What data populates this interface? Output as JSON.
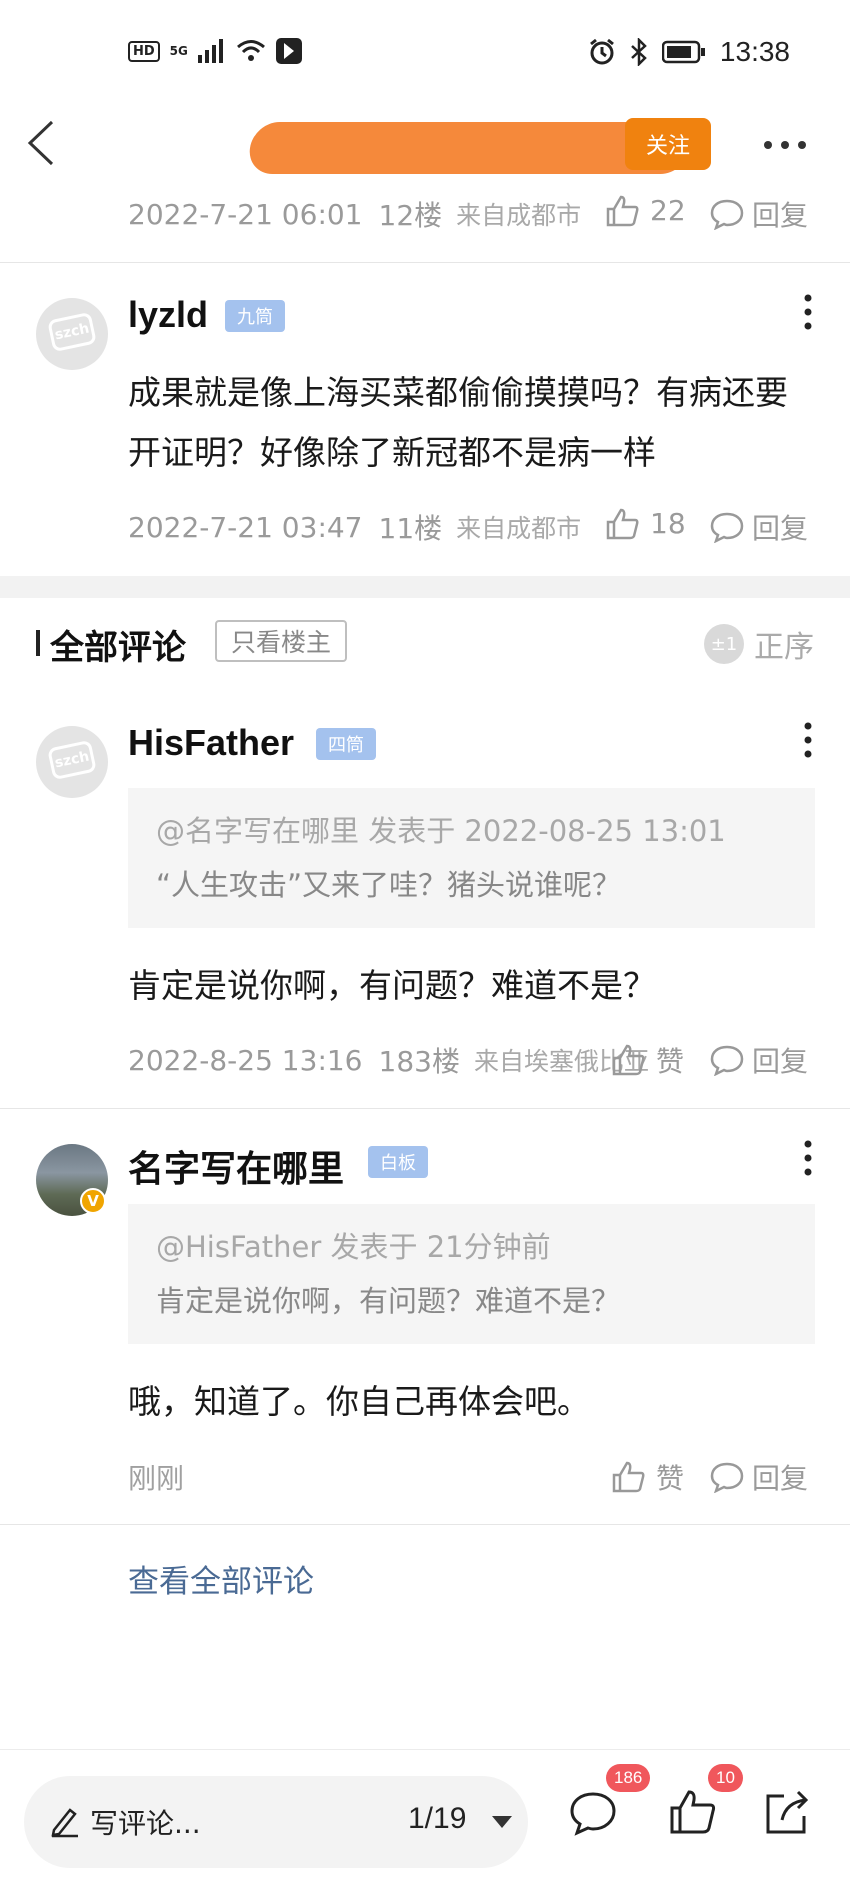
{
  "status_bar": {
    "hd": "HD",
    "network": "5G",
    "time": "13:38"
  },
  "nav": {
    "follow_label": "关注"
  },
  "comments_top": [
    {
      "date": "2022-7-21 06:01",
      "floor": "12楼",
      "from": "来自成都市",
      "likes": "22",
      "reply": "回复"
    },
    {
      "username": "lyzld",
      "level": "九筒",
      "text": "成果就是像上海买菜都偷偷摸摸吗？有病还要开证明？好像除了新冠都不是病一样",
      "date": "2022-7-21 03:47",
      "floor": "11楼",
      "from": "来自成都市",
      "likes": "18",
      "reply": "回复",
      "avatar_text": "szch"
    }
  ],
  "section": {
    "title": "全部评论",
    "only_op": "只看楼主",
    "sort_label": "正序",
    "sort_icon": "±1"
  },
  "comments": [
    {
      "username": "HisFather",
      "level": "四筒",
      "avatar_text": "szch",
      "quote_header": "@名字写在哪里 发表于 2022-08-25 13:01",
      "quote_body": "“人生攻击”又来了哇？猪头说谁呢？",
      "text": "肯定是说你啊，有问题？难道不是？",
      "date": "2022-8-25 13:16",
      "floor": "183楼",
      "from": "来自埃塞俄比亚",
      "like_label": "赞",
      "reply": "回复"
    },
    {
      "username": "名字写在哪里",
      "level": "白板",
      "badge": "V",
      "quote_header": "@HisFather 发表于 21分钟前",
      "quote_body": "肯定是说你啊，有问题？难道不是？",
      "text": "哦，知道了。你自己再体会吧。",
      "time": "刚刚",
      "like_label": "赞",
      "reply": "回复"
    }
  ],
  "view_all": "查看全部评论",
  "bottom_bar": {
    "placeholder": "写评论...",
    "page": "1/19",
    "comment_count": "186",
    "like_count": "10"
  },
  "colors": {
    "accent_orange": "#f0820f",
    "level_badge": "#a4c2ee",
    "link_blue": "#4a6a94",
    "badge_red": "#f0575c"
  }
}
